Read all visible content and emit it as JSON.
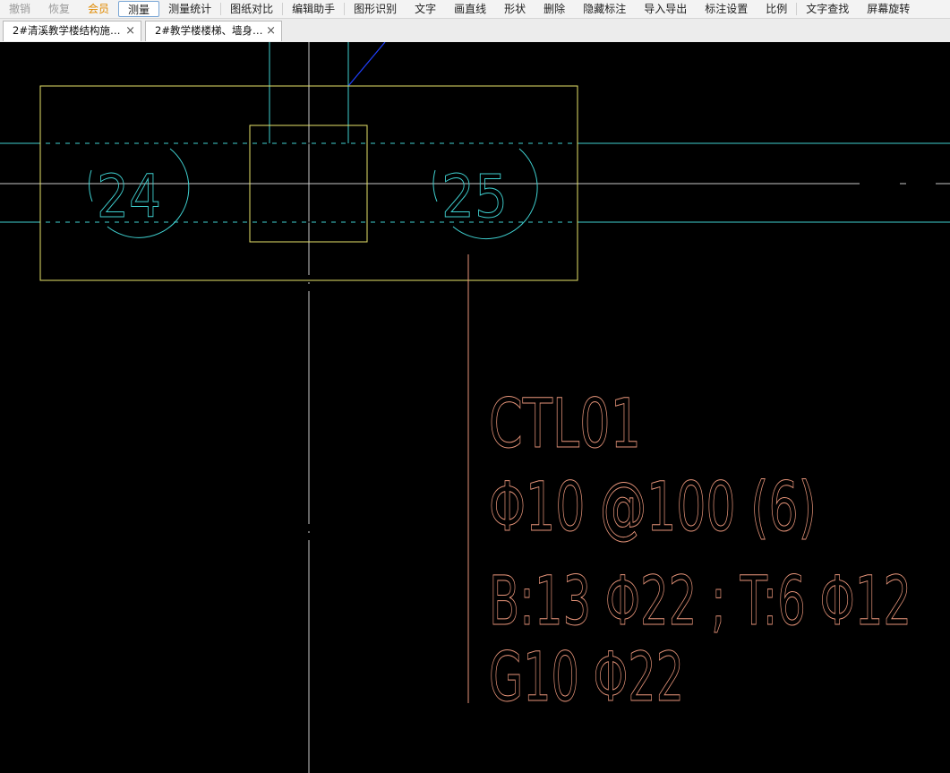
{
  "toolbar": {
    "items": [
      "撤销",
      "恢复",
      "会员",
      "测量",
      "测量统计",
      "图纸对比",
      "编辑助手",
      "图形识别",
      "文字",
      "画直线",
      "形状",
      "删除",
      "隐藏标注",
      "导入导出",
      "标注设置",
      "比例",
      "文字查找",
      "屏幕旋转"
    ],
    "active": "测量"
  },
  "tabs": [
    {
      "label": "2#清溪教学楼结构施…",
      "close": "×"
    },
    {
      "label": "2#教学楼楼梯、墙身…",
      "close": "×"
    }
  ],
  "drawing": {
    "grid_labels": [
      "24",
      "25"
    ],
    "beam_annotation": {
      "name": "CTL01",
      "stirrup": "Φ10 @100 (6)",
      "longitudinal": "B:13 Φ22 ; T:6 Φ12",
      "side": "G10 Φ22"
    },
    "colors": {
      "background": "#000000",
      "outline": "#e8e36a",
      "axis": "#3fd0d0",
      "text": "#e8957a",
      "gridline": "#c8c8c8",
      "leader": "#2040ff"
    }
  }
}
